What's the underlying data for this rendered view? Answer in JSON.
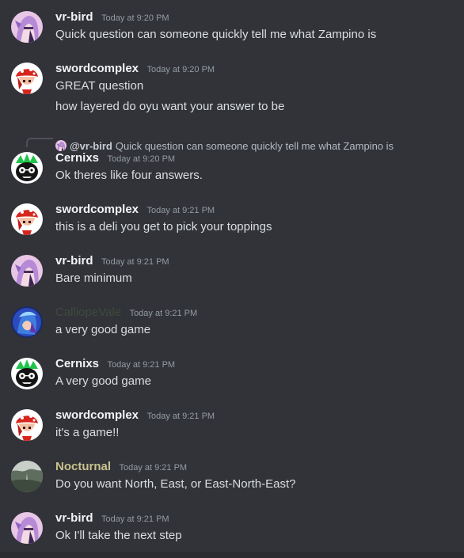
{
  "messages": [
    {
      "user": "vr-bird",
      "user_color": "#f2f3f5",
      "timestamp": "Today at 9:20 PM",
      "avatar_icon": "vr-bird-avatar-icon",
      "lines": [
        "Quick question can someone quickly tell me what Zampino is"
      ]
    },
    {
      "user": "swordcomplex",
      "user_color": "#f2f3f5",
      "timestamp": "Today at 9:20 PM",
      "avatar_icon": "swordcomplex-avatar-icon",
      "lines": [
        "GREAT question",
        "how layered do oyu want your answer to be"
      ]
    },
    {
      "reply": {
        "name": "@vr-bird",
        "text": "Quick question can someone quickly tell me what Zampino is"
      },
      "user": "Cernixs",
      "user_color": "#f2f3f5",
      "timestamp": "Today at 9:20 PM",
      "avatar_icon": "cernixs-avatar-icon",
      "lines": [
        "Ok theres like four answers."
      ]
    },
    {
      "user": "swordcomplex",
      "user_color": "#f2f3f5",
      "timestamp": "Today at 9:21 PM",
      "avatar_icon": "swordcomplex-avatar-icon",
      "lines": [
        "this is a deli you get to pick your toppings"
      ]
    },
    {
      "user": "vr-bird",
      "user_color": "#f2f3f5",
      "timestamp": "Today at 9:21 PM",
      "avatar_icon": "vr-bird-avatar-icon",
      "lines": [
        "Bare minimum"
      ]
    },
    {
      "user": "CalliopeVale",
      "user_color": "#3f4a3c",
      "timestamp": "Today at 9:21 PM",
      "avatar_icon": "calliopevale-avatar-icon",
      "lines": [
        "a very good game"
      ]
    },
    {
      "user": "Cernixs",
      "user_color": "#f2f3f5",
      "timestamp": "Today at 9:21 PM",
      "avatar_icon": "cernixs-avatar-icon",
      "lines": [
        "A very good game"
      ]
    },
    {
      "user": "swordcomplex",
      "user_color": "#f2f3f5",
      "timestamp": "Today at 9:21 PM",
      "avatar_icon": "swordcomplex-avatar-icon",
      "lines": [
        "it's a game!!"
      ]
    },
    {
      "user": "Nocturnal",
      "user_color": "#c9c28e",
      "timestamp": "Today at 9:21 PM",
      "avatar_icon": "nocturnal-avatar-icon",
      "lines": [
        "Do you want North, East, or East-North-East?"
      ]
    },
    {
      "user": "vr-bird",
      "user_color": "#f2f3f5",
      "timestamp": "Today at 9:21 PM",
      "avatar_icon": "vr-bird-avatar-icon",
      "lines": [
        "Ok I'll take the next step"
      ]
    }
  ]
}
